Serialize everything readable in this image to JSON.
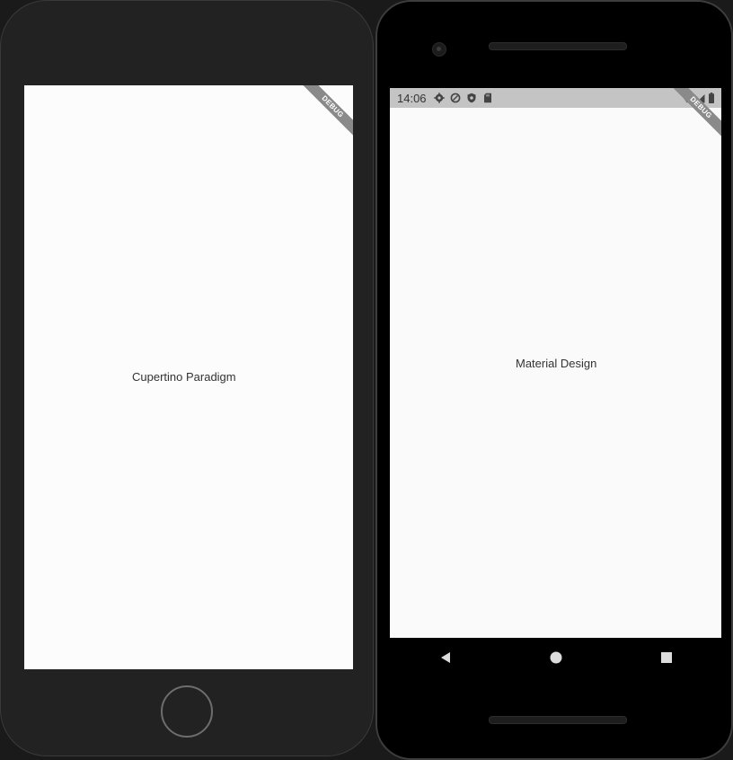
{
  "devices": {
    "iphone": {
      "screen_label": "Cupertino Paradigm",
      "debug_banner": "DEBUG"
    },
    "pixel": {
      "status_time": "14:06",
      "screen_label": "Material Design",
      "debug_banner": "DEBUG",
      "status_icons_left": [
        "settings-icon",
        "data-saver-icon",
        "shield-icon",
        "sd-card-icon"
      ],
      "status_icons_right": [
        "wifi-icon",
        "signal-icon",
        "battery-icon"
      ],
      "nav_buttons": [
        "back-icon",
        "home-icon",
        "recents-icon"
      ]
    }
  },
  "colors": {
    "iphone_body": "#222222",
    "pixel_body": "#000000",
    "screen_bg": "#fcfcfc",
    "status_bar": "#c4c4c4",
    "debug_banner": "#8a8a8a"
  }
}
